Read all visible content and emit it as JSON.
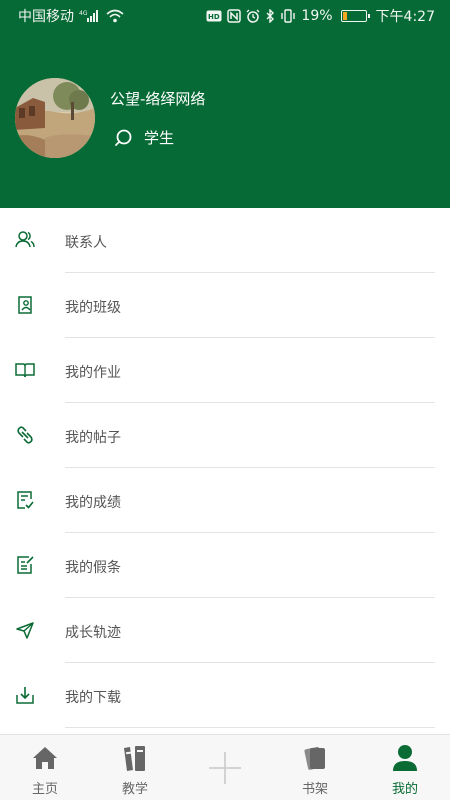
{
  "status_bar": {
    "carrier": "中国移动",
    "network": "4G",
    "battery_percent": "19%",
    "time": "下午4:27",
    "icons": [
      "signal-icon",
      "wifi-icon",
      "hd-icon",
      "nfc-icon",
      "alarm-icon",
      "bluetooth-icon",
      "vibrate-icon",
      "battery-icon"
    ]
  },
  "profile": {
    "name": "公望-络绎网络",
    "role": "学生"
  },
  "menu": {
    "items": [
      {
        "label": "联系人",
        "icon": "contacts-icon"
      },
      {
        "label": "我的班级",
        "icon": "class-icon"
      },
      {
        "label": "我的作业",
        "icon": "homework-book-icon"
      },
      {
        "label": "我的帖子",
        "icon": "link-icon"
      },
      {
        "label": "我的成绩",
        "icon": "grade-check-icon"
      },
      {
        "label": "我的假条",
        "icon": "leave-note-icon"
      },
      {
        "label": "成长轨迹",
        "icon": "paper-plane-icon"
      },
      {
        "label": "我的下载",
        "icon": "download-icon"
      }
    ]
  },
  "tabbar": {
    "tabs": [
      {
        "label": "主页",
        "icon": "home-icon"
      },
      {
        "label": "教学",
        "icon": "books-icon"
      },
      {
        "label": "",
        "icon": "plus-icon"
      },
      {
        "label": "书架",
        "icon": "bookshelf-icon"
      },
      {
        "label": "我的",
        "icon": "person-icon",
        "active": true
      }
    ]
  },
  "colors": {
    "header_bg": "#056a35",
    "accent": "#0b6b35",
    "battery_fill": "#f5a623",
    "menu_text": "#555555",
    "divider": "#e3e3e3"
  }
}
